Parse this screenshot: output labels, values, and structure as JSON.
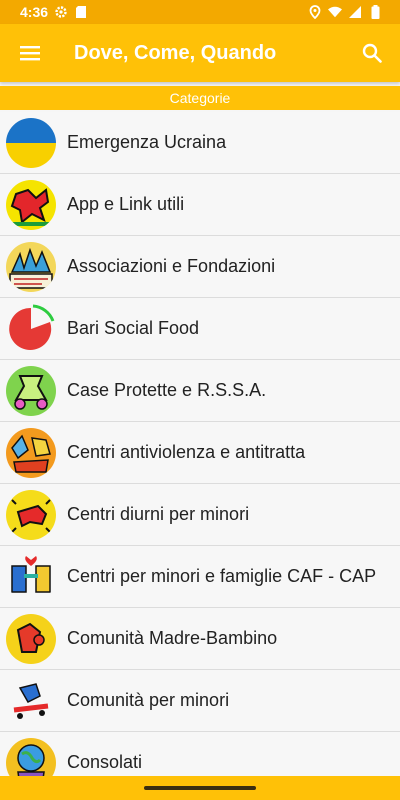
{
  "status_bar": {
    "time": "4:36"
  },
  "app_bar": {
    "title": "Dove, Come, Quando"
  },
  "section_header": "Categorie",
  "categories": [
    {
      "label": "Emergenza Ucraina",
      "icon": "ukraine-flag-icon"
    },
    {
      "label": "App e Link utili",
      "icon": "red-figure-icon"
    },
    {
      "label": "Associazioni e Fondazioni",
      "icon": "peace-crowd-icon"
    },
    {
      "label": "Bari Social Food",
      "icon": "pie-chart-icon"
    },
    {
      "label": "Case Protette e R.S.S.A.",
      "icon": "green-figure-icon"
    },
    {
      "label": "Centri antiviolenza e antitratta",
      "icon": "dancing-figures-icon"
    },
    {
      "label": "Centri diurni per minori",
      "icon": "crawling-baby-icon"
    },
    {
      "label": "Centri per minori e famiglie CAF - CAP",
      "icon": "heart-figures-icon"
    },
    {
      "label": "Comunità Madre-Bambino",
      "icon": "mother-child-icon"
    },
    {
      "label": "Comunità per minori",
      "icon": "skater-icon"
    },
    {
      "label": "Consolati",
      "icon": "globe-figure-icon"
    }
  ],
  "colors": {
    "primary": "#ffc107",
    "status_bar": "#f3a900",
    "list_bg": "#f7f7f7",
    "text": "#222222"
  }
}
